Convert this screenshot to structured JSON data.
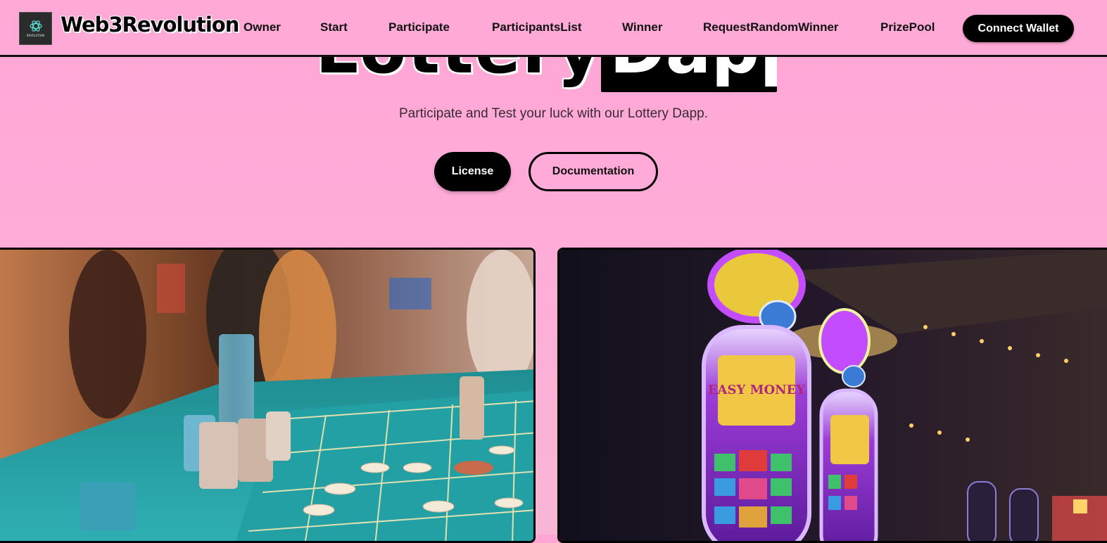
{
  "header": {
    "logo_text": "REVOLUTION",
    "brand": "Web3Revolution",
    "nav": [
      {
        "label": "Owner"
      },
      {
        "label": "Start"
      },
      {
        "label": "Participate"
      },
      {
        "label": "ParticipantsList"
      },
      {
        "label": "Winner"
      },
      {
        "label": "RequestRandomWinner"
      },
      {
        "label": "PrizePool"
      }
    ],
    "connect_label": "Connect Wallet"
  },
  "hero": {
    "title_left": "Lottery",
    "title_right": "Dapp",
    "subtitle": "Participate and Test your luck with our Lottery Dapp.",
    "license_label": "License",
    "documentation_label": "Documentation"
  },
  "images": [
    {
      "name": "casino-roulette-photo"
    },
    {
      "name": "slot-machines-photo",
      "sign_text": "EASY MONEY"
    }
  ],
  "colors": {
    "page_bg": "#ffa6d6",
    "accent_dark": "#000000",
    "table_teal": "#2aa3a8"
  }
}
